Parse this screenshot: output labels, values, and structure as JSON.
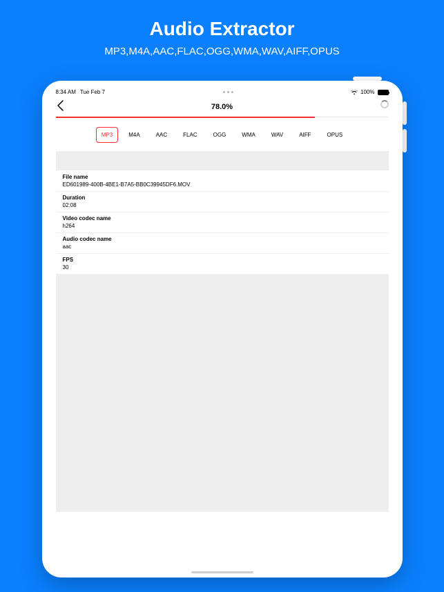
{
  "promo": {
    "title": "Audio Extractor",
    "subtitle": "MP3,M4A,AAC,FLAC,OGG,WMA,WAV,AIFF,OPUS"
  },
  "statusbar": {
    "time": "8:34 AM",
    "date": "Tue Feb 7",
    "battery_text": "100%"
  },
  "nav": {
    "progress_label": "78.0%"
  },
  "tabs": [
    "MP3",
    "M4A",
    "AAC",
    "FLAC",
    "OGG",
    "WMA",
    "WAV",
    "AIFF",
    "OPUS"
  ],
  "active_tab": "MP3",
  "info": {
    "filename_label": "File name",
    "filename_value": "ED601989-400B-4BE1-B7A5-BB0C39945DF6.MOV",
    "duration_label": "Duration",
    "duration_value": "02:08",
    "video_codec_label": "Video codec name",
    "video_codec_value": "h264",
    "audio_codec_label": "Audio codec name",
    "audio_codec_value": "aac",
    "fps_label": "FPS",
    "fps_value": "30"
  }
}
